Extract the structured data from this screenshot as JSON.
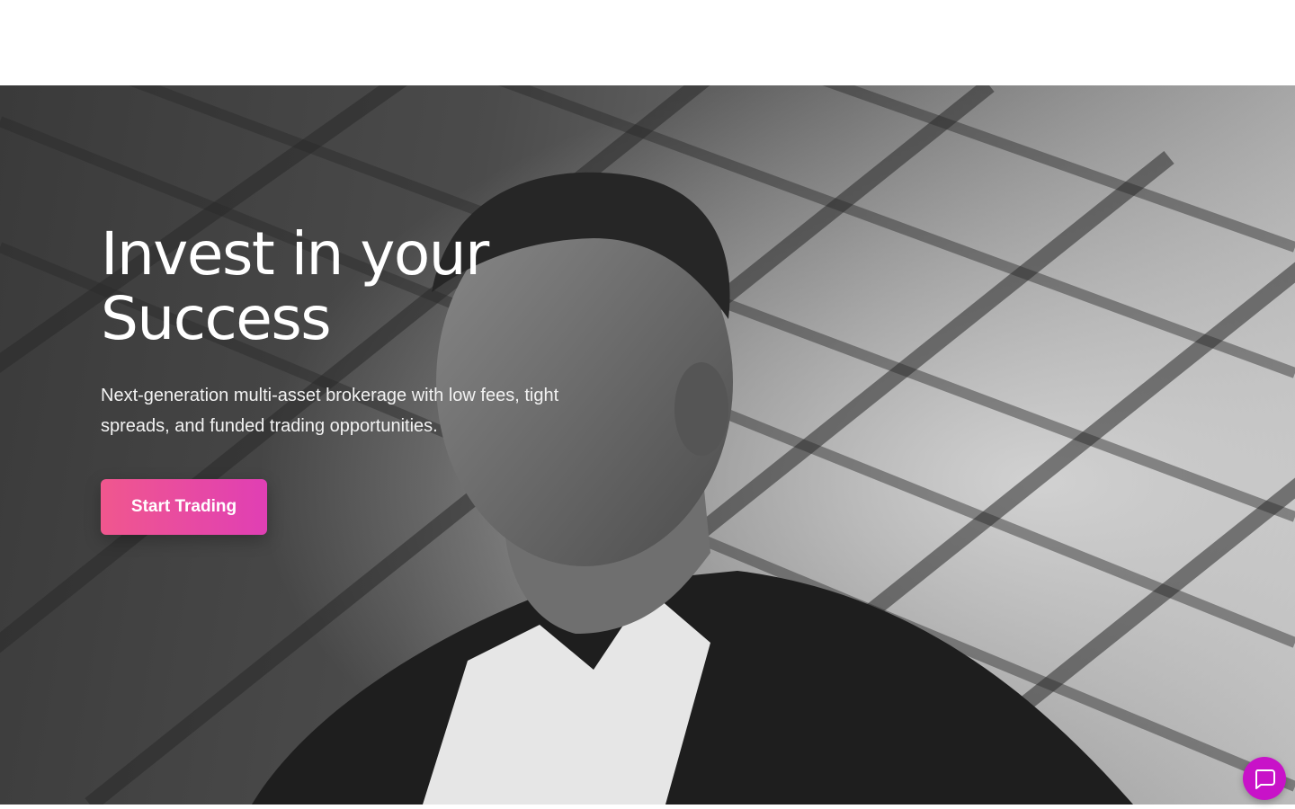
{
  "hero": {
    "title": "Invest in your Success",
    "subtitle": "Next-generation multi-asset brokerage with low fees, tight spreads, and funded trading opportunities.",
    "cta_label": "Start Trading",
    "image": "black-and-white photo of a smiling man in a dark suit under a glass lattice roof"
  },
  "chat": {
    "icon": "chat-bubble-icon"
  },
  "colors": {
    "cta_gradient_start": "#f0578e",
    "cta_gradient_end": "#e03fb4",
    "chat_button": "#c812c8",
    "text_on_hero": "#ffffff"
  }
}
